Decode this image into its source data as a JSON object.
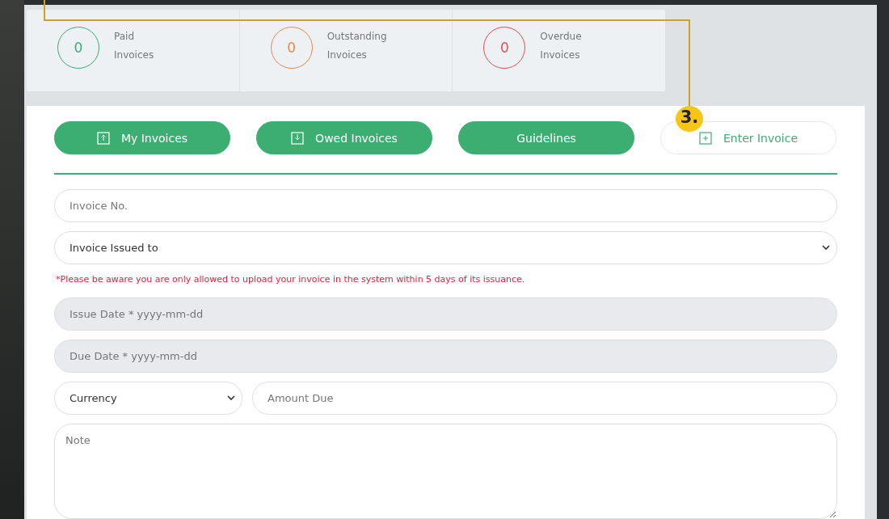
{
  "stats": [
    {
      "count": "0",
      "label": "Paid Invoices",
      "color": "#3dae72"
    },
    {
      "count": "0",
      "label": "Outstanding Invoices",
      "color": "#e8894a"
    },
    {
      "count": "0",
      "label": "Overdue Invoices",
      "color": "#e05050"
    }
  ],
  "tabs": [
    {
      "label": "My Invoices",
      "kind": "upload",
      "selected": false
    },
    {
      "label": "Owed Invoices",
      "kind": "download",
      "selected": false
    },
    {
      "label": "Guidelines",
      "kind": "plain",
      "selected": false
    },
    {
      "label": "Enter Invoice",
      "kind": "add",
      "selected": true
    }
  ],
  "annotation": {
    "label": "3."
  },
  "form": {
    "invoice_no": {
      "placeholder": "Invoice No."
    },
    "issued_to": {
      "value": "Invoice Issued to"
    },
    "warning": "*Please be aware you are only allowed to upload your invoice in the system within 5 days of its issuance.",
    "issue_date": {
      "placeholder": "Issue Date * yyyy-mm-dd",
      "disabled": true
    },
    "due_date": {
      "placeholder": "Due Date * yyyy-mm-dd",
      "disabled": true
    },
    "currency": {
      "value": "Currency"
    },
    "amount": {
      "placeholder": "Amount Due"
    },
    "note": {
      "placeholder": "Note"
    }
  }
}
